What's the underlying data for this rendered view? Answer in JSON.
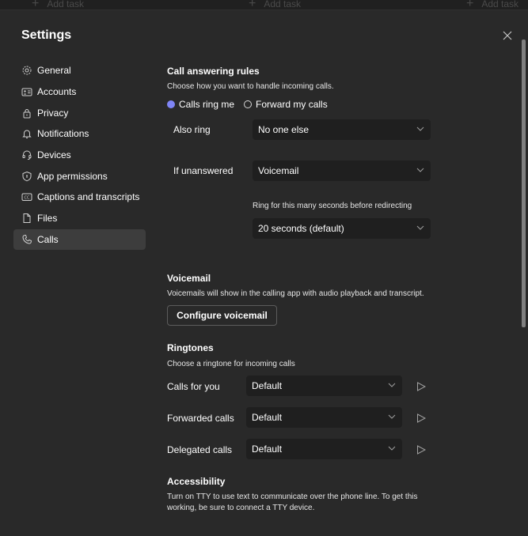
{
  "background": {
    "tasks": [
      {
        "label": "Add task"
      },
      {
        "label": "Add task"
      },
      {
        "label": "Add task"
      }
    ]
  },
  "dialog": {
    "title": "Settings",
    "close_icon": "close-icon"
  },
  "sidebar": {
    "items": [
      {
        "label": "General",
        "icon": "gear-icon",
        "active": false
      },
      {
        "label": "Accounts",
        "icon": "contact-card-icon",
        "active": false
      },
      {
        "label": "Privacy",
        "icon": "lock-icon",
        "active": false
      },
      {
        "label": "Notifications",
        "icon": "bell-icon",
        "active": false
      },
      {
        "label": "Devices",
        "icon": "headset-icon",
        "active": false
      },
      {
        "label": "App permissions",
        "icon": "shield-icon",
        "active": false
      },
      {
        "label": "Captions and transcripts",
        "icon": "closed-captions-icon",
        "active": false
      },
      {
        "label": "Files",
        "icon": "document-icon",
        "active": false
      },
      {
        "label": "Calls",
        "icon": "phone-icon",
        "active": true
      }
    ]
  },
  "call_answering": {
    "heading": "Call answering rules",
    "description": "Choose how you want to handle incoming calls.",
    "options": [
      {
        "label": "Calls ring me",
        "selected": true
      },
      {
        "label": "Forward my calls",
        "selected": false
      }
    ],
    "also_ring": {
      "label": "Also ring",
      "value": "No one else"
    },
    "if_unanswered": {
      "label": "If unanswered",
      "value": "Voicemail"
    },
    "ring_duration": {
      "label": "Ring for this many seconds before redirecting",
      "value": "20 seconds (default)"
    }
  },
  "voicemail": {
    "heading": "Voicemail",
    "description": "Voicemails will show in the calling app with audio playback and transcript.",
    "button_label": "Configure voicemail"
  },
  "ringtones": {
    "heading": "Ringtones",
    "description": "Choose a ringtone for incoming calls",
    "rows": [
      {
        "label": "Calls for you",
        "value": "Default"
      },
      {
        "label": "Forwarded calls",
        "value": "Default"
      },
      {
        "label": "Delegated calls",
        "value": "Default"
      }
    ]
  },
  "accessibility": {
    "heading": "Accessibility",
    "description": "Turn on TTY to use text to communicate over the phone line. To get this working, be sure to connect a TTY device."
  },
  "colors": {
    "accent": "#7f85f5",
    "dialog_bg": "#292929",
    "field_bg": "#1f1f1f",
    "active_nav_bg": "#3d3d3d"
  }
}
